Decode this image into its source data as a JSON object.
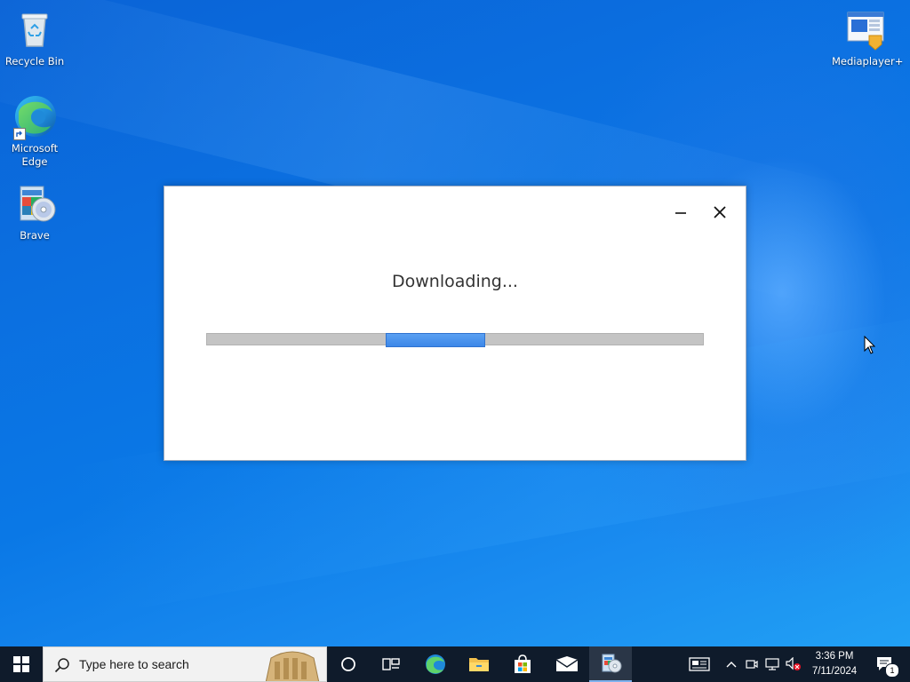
{
  "desktop": {
    "icons_left": [
      {
        "label": "Recycle Bin",
        "icon": "recycle-bin-icon"
      },
      {
        "label": "Microsoft Edge",
        "icon": "edge-icon"
      },
      {
        "label": "Brave",
        "icon": "installer-icon"
      }
    ],
    "icons_right": [
      {
        "label": "Mediaplayer+",
        "icon": "media-player-icon"
      }
    ]
  },
  "dialog": {
    "title": "Downloading...",
    "minimize_icon": "minimize-icon",
    "close_icon": "close-icon",
    "progress": {
      "mode": "indeterminate",
      "chunk_start_fraction": 0.36,
      "chunk_end_fraction": 0.56,
      "chunk_color": "#3c87e8",
      "track_color": "#c4c4c4"
    }
  },
  "taskbar": {
    "start_icon": "windows-start-icon",
    "search": {
      "placeholder": "Type here to search"
    },
    "apps": [
      {
        "name": "cortana",
        "icon": "cortana-circle-icon"
      },
      {
        "name": "task-view",
        "icon": "task-view-icon"
      },
      {
        "name": "edge",
        "icon": "edge-icon"
      },
      {
        "name": "file-explorer",
        "icon": "folder-icon"
      },
      {
        "name": "store",
        "icon": "store-bag-icon"
      },
      {
        "name": "mail",
        "icon": "mail-icon"
      },
      {
        "name": "installer",
        "icon": "installer-icon",
        "active": true
      }
    ],
    "tray": {
      "news_icon": "news-icon",
      "chevron_icon": "chevron-up-icon",
      "meet_icon": "meet-now-icon",
      "network_icon": "network-icon",
      "volume_icon": "volume-muted-icon",
      "time": "3:36 PM",
      "date": "7/11/2024",
      "notification_count": "1"
    }
  },
  "colors": {
    "taskbar": "#0f1b2b",
    "desktop_blue": "#0b6fe0",
    "accent": "#3c87e8"
  }
}
